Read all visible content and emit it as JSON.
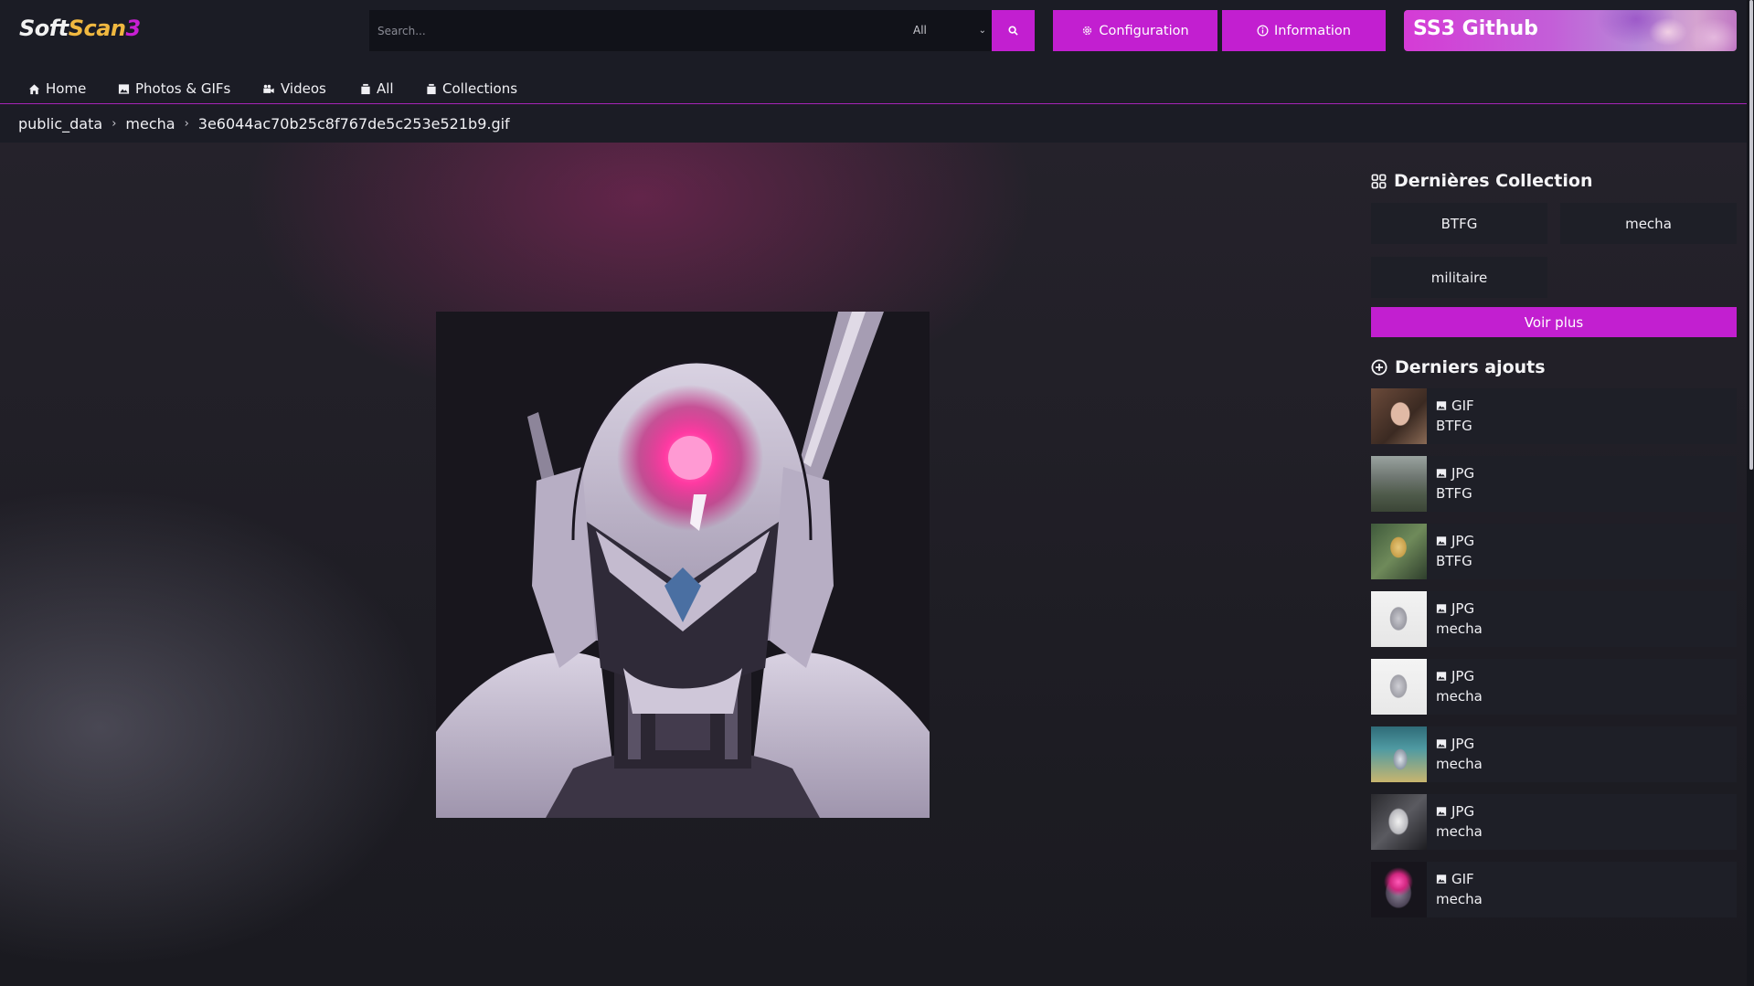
{
  "app": {
    "logo_soft": "Soft",
    "logo_scan": "Scan",
    "logo_num": "3"
  },
  "search": {
    "placeholder": "Search...",
    "filter_selected": "All",
    "button_icon": "search-icon"
  },
  "header": {
    "config_label": "Configuration",
    "info_label": "Information",
    "github_label": "SS3 Github"
  },
  "nav": {
    "items": [
      {
        "label": "Home",
        "icon": "home-icon"
      },
      {
        "label": "Photos & GIFs",
        "icon": "image-icon"
      },
      {
        "label": "Videos",
        "icon": "video-icon"
      },
      {
        "label": "All",
        "icon": "folder-icon"
      },
      {
        "label": "Collections",
        "icon": "folder-icon"
      }
    ]
  },
  "breadcrumb": {
    "items": [
      "public_data",
      "mecha",
      "3e6044ac70b25c8f767de5c253e521b9.gif"
    ]
  },
  "sidebar": {
    "collections_title": "Dernières Collection",
    "collections": [
      "BTFG",
      "mecha",
      "militaire"
    ],
    "voir_plus": "Voir plus",
    "recent_title": "Derniers ajouts",
    "recent": [
      {
        "type": "GIF",
        "collection": "BTFG"
      },
      {
        "type": "JPG",
        "collection": "BTFG"
      },
      {
        "type": "JPG",
        "collection": "BTFG"
      },
      {
        "type": "JPG",
        "collection": "mecha"
      },
      {
        "type": "JPG",
        "collection": "mecha"
      },
      {
        "type": "JPG",
        "collection": "mecha"
      },
      {
        "type": "JPG",
        "collection": "mecha"
      },
      {
        "type": "GIF",
        "collection": "mecha"
      }
    ]
  },
  "colors": {
    "accent": "#c21fd0",
    "header_bg": "#1b1c25",
    "tile_bg": "#1e1f27",
    "logo_scan": "#f0b840"
  }
}
